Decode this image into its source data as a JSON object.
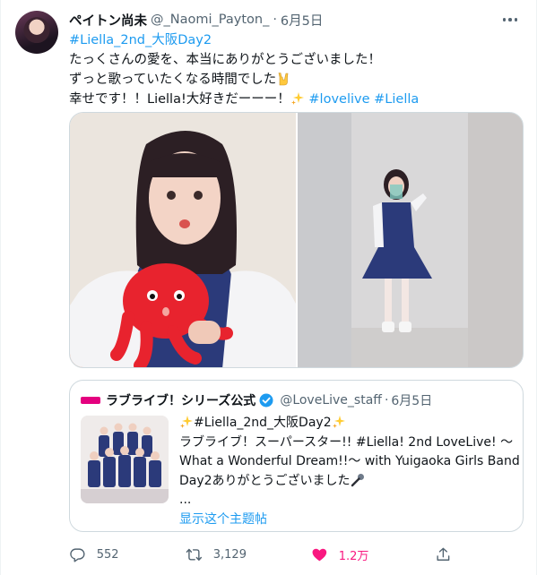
{
  "author": {
    "display_name": "ペイトン尚未",
    "handle": "@_Naomi_Payton_",
    "separator": "·",
    "time": "6月5日"
  },
  "tweet": {
    "hashtag_line": "#Liella_2nd_大阪Day2",
    "line2": "たっくさんの愛を、本当にありがとうございました！",
    "line3": "ずっと歌っていたくなる時間でした",
    "line4_text": "幸せです！！Liella!大好きだーーー！",
    "tags": [
      "#lovelive",
      "#Liella"
    ]
  },
  "quoted_tweet": {
    "display_name": "ラブライブ！シリーズ公式",
    "handle": "@LoveLive_staff",
    "separator": "·",
    "time": "6月5日",
    "line1": "#Liella_2nd_大阪Day2",
    "line2": "ラブライブ！スーパースター!! #Liella! 2nd LoveLive! ～",
    "line3": "What a Wonderful Dream!!～ with Yuigaoka Girls Band",
    "line4": "Day2ありがとうございました",
    "ellipsis": "...",
    "show_thread": "显示这个主题帖"
  },
  "actions": {
    "replies": "552",
    "retweets": "3,129",
    "likes": "1.2万"
  },
  "colors": {
    "link": "#1d9bf0",
    "like": "#f91880",
    "muted": "#536471",
    "text": "#0f1419",
    "border": "#cfd9de"
  },
  "icons": [
    "more-icon",
    "sparkle-emoji-icon",
    "rock-hand-emoji-icon",
    "verified-badge-icon",
    "microphone-emoji-icon",
    "reply-icon",
    "retweet-icon",
    "like-icon",
    "share-icon"
  ]
}
